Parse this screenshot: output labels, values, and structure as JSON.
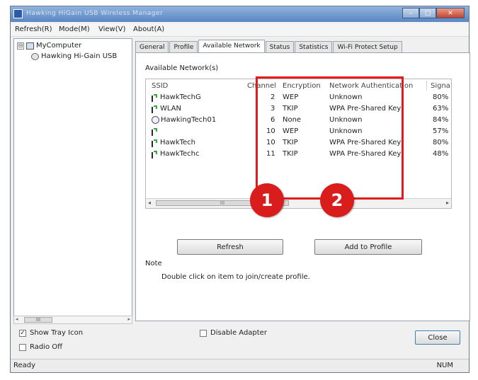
{
  "window": {
    "title": "Hawking HiGain USB Wireless Manager",
    "controls": {
      "minimize": "‒",
      "maximize": "□",
      "close": "✕"
    }
  },
  "menu": [
    "Refresh(R)",
    "Mode(M)",
    "View(V)",
    "About(A)"
  ],
  "tree": {
    "root": "MyComputer",
    "expander": "⊟",
    "child": "Hawking Hi-Gain USB"
  },
  "tabs": [
    "General",
    "Profile",
    "Available Network",
    "Status",
    "Statistics",
    "Wi-Fi Protect Setup"
  ],
  "available_network": {
    "section_label": "Available Network(s)",
    "columns": [
      "SSID",
      "Channel",
      "Encryption",
      "Network Authentication",
      "Signal"
    ],
    "rows": [
      {
        "ssid": "HawkTechG",
        "channel": "2",
        "encryption": "WEP",
        "auth": "Unknown",
        "signal": "80%",
        "icon": "wifi-icon"
      },
      {
        "ssid": "WLAN",
        "channel": "3",
        "encryption": "TKIP",
        "auth": "WPA Pre-Shared Key",
        "signal": "63%",
        "icon": "wifi-icon"
      },
      {
        "ssid": "HawkingTech01",
        "channel": "6",
        "encryption": "None",
        "auth": "Unknown",
        "signal": "84%",
        "icon": "globe-icon"
      },
      {
        "ssid": "",
        "channel": "10",
        "encryption": "WEP",
        "auth": "Unknown",
        "signal": "57%",
        "icon": "wifi-icon"
      },
      {
        "ssid": "HawkTech",
        "channel": "10",
        "encryption": "TKIP",
        "auth": "WPA Pre-Shared Key",
        "signal": "80%",
        "icon": "wifi-icon"
      },
      {
        "ssid": "HawkTechc",
        "channel": "11",
        "encryption": "TKIP",
        "auth": "WPA Pre-Shared Key",
        "signal": "48%",
        "icon": "wifi-icon"
      }
    ],
    "refresh_label": "Refresh",
    "add_profile_label": "Add to Profile",
    "note_title": "Note",
    "note_text": "Double click on item to join/create profile."
  },
  "scroll": {
    "left_arrow": "◂",
    "right_arrow": "▸",
    "thumb": "III"
  },
  "options": {
    "show_tray_icon": "Show Tray Icon",
    "radio_off": "Radio Off",
    "disable_adapter": "Disable Adapter",
    "check_mark": "✓"
  },
  "close_label": "Close",
  "status": {
    "left": "Ready",
    "right": "NUM"
  },
  "callouts": [
    "1",
    "2"
  ],
  "colors": {
    "callout_red": "#d91d1d"
  }
}
